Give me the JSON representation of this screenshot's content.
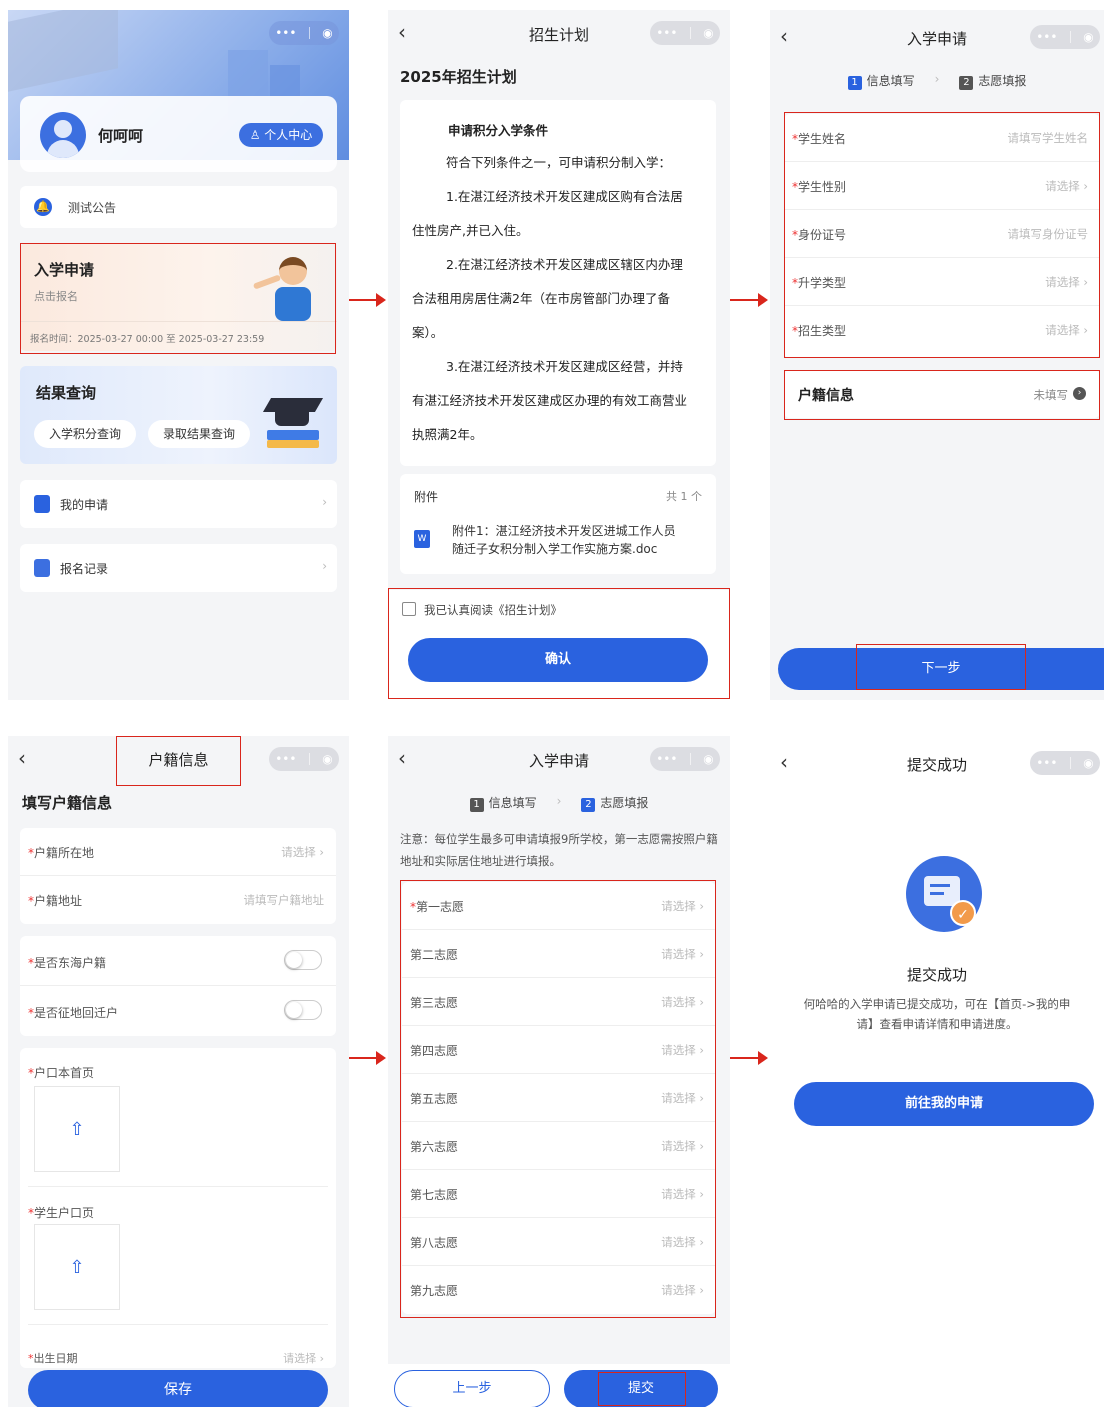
{
  "s1": {
    "user_name": "何呵呵",
    "personal_center": "个人中心",
    "notice": "测试公告",
    "apply_title": "入学申请",
    "apply_sub": "点击报名",
    "apply_time": "报名时间：2025-03-27 00:00 至 2025-03-27 23:59",
    "result_title": "结果查询",
    "btn_points": "入学积分查询",
    "btn_admit": "录取结果查询",
    "my_apply": "我的申请",
    "records": "报名记录"
  },
  "s2": {
    "nav_title": "招生计划",
    "heading": "2025年招生计划",
    "sub_heading": "申请积分入学条件",
    "p1": "符合下列条件之一，可申请积分制入学：",
    "p2a": "1.在湛江经济技术开发区建成区购有合法居",
    "p2b": "住性房产,并已入住。",
    "p3a": "2.在湛江经济技术开发区建成区辖区内办理",
    "p3b": "合法租用房居住满2年（在市房管部门办理了备",
    "p3c": "案）。",
    "p4a": "3.在湛江经济技术开发区建成区经营，并持",
    "p4b": "有湛江经济技术开发区建成区办理的有效工商营业",
    "p4c": "执照满2年。",
    "attach_label": "附件",
    "attach_count": "共 1 个",
    "attach_file_a": "附件1：湛江经济技术开发区进城工作人员",
    "attach_file_b": "随迁子女积分制入学工作实施方案.doc",
    "agree": "我已认真阅读《招生计划》",
    "confirm": "确认"
  },
  "s3": {
    "nav_title": "入学申请",
    "step1": "信息填写",
    "step2": "志愿填报",
    "rows": [
      {
        "label": "学生姓名",
        "value": "请填写学生姓名"
      },
      {
        "label": "学生性别",
        "value": "请选择 ›"
      },
      {
        "label": "身份证号",
        "value": "请填写身份证号"
      },
      {
        "label": "升学类型",
        "value": "请选择 ›"
      },
      {
        "label": "招生类型",
        "value": "请选择 ›"
      }
    ],
    "huji_title": "户籍信息",
    "huji_status": "未填写",
    "next": "下一步"
  },
  "s4": {
    "nav_title": "户籍信息",
    "heading": "填写户籍信息",
    "row_loc": "户籍所在地",
    "row_loc_val": "请选择 ›",
    "row_addr": "户籍地址",
    "row_addr_val": "请填写户籍地址",
    "row_donghai": "是否东海户籍",
    "row_zhengdi": "是否征地回迁户",
    "hukou_home": "户口本首页",
    "hukou_student": "学生户口页",
    "birth": "出生日期",
    "birth_val": "请选择 ›",
    "save": "保存"
  },
  "s5": {
    "nav_title": "入学申请",
    "step1": "信息填写",
    "step2": "志愿填报",
    "note": "注意：每位学生最多可申请填报9所学校，第一志愿需按照户籍地址和实际居住地址进行填报。",
    "choices": [
      {
        "label": "第一志愿",
        "value": "请选择 ›"
      },
      {
        "label": "第二志愿",
        "value": "请选择 ›"
      },
      {
        "label": "第三志愿",
        "value": "请选择 ›"
      },
      {
        "label": "第四志愿",
        "value": "请选择 ›"
      },
      {
        "label": "第五志愿",
        "value": "请选择 ›"
      },
      {
        "label": "第六志愿",
        "value": "请选择 ›"
      },
      {
        "label": "第七志愿",
        "value": "请选择 ›"
      },
      {
        "label": "第八志愿",
        "value": "请选择 ›"
      },
      {
        "label": "第九志愿",
        "value": "请选择 ›"
      }
    ],
    "prev": "上一步",
    "submit": "提交"
  },
  "s6": {
    "nav_title": "提交成功",
    "title": "提交成功",
    "desc1": "何哈哈的入学申请已提交成功，可在【首页->我的申",
    "desc2": "请】查看申请详情和申请进度。",
    "goto": "前往我的申请"
  },
  "colors": {
    "accent": "#2a62df",
    "highlight_border": "#d9261c",
    "required_star": "#e33"
  }
}
